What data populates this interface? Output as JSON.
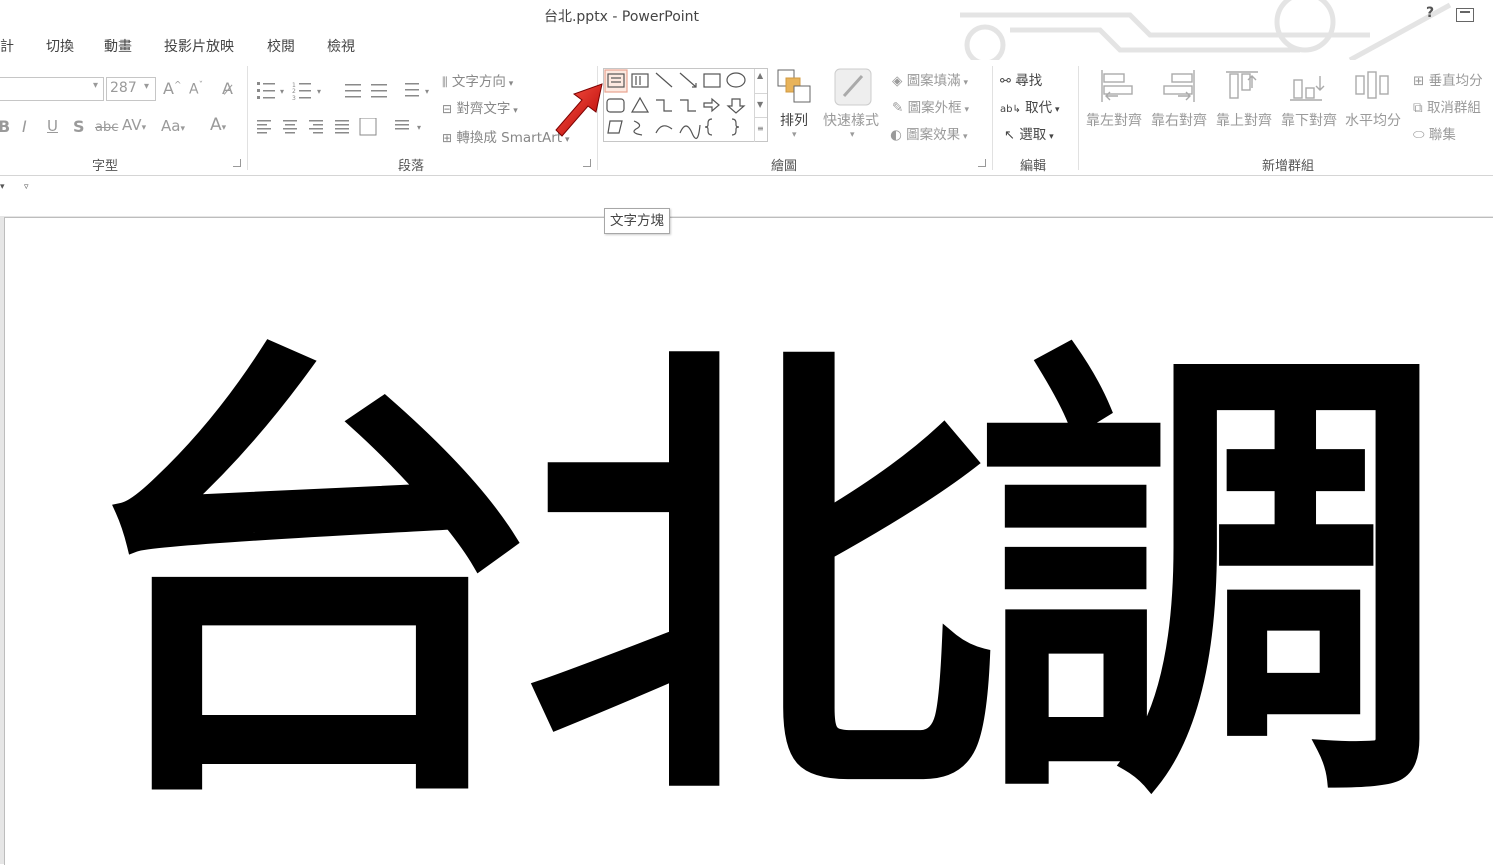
{
  "window": {
    "title": "台北.pptx - PowerPoint",
    "help": "?"
  },
  "tabs": [
    "計",
    "切換",
    "動畫",
    "投影片放映",
    "校閱",
    "檢視"
  ],
  "font_group": {
    "font_size": "287",
    "label": "字型"
  },
  "paragraph_group": {
    "text_direction": "文字方向",
    "align_text": "對齊文字",
    "convert_smartart": "轉換成 SmartArt",
    "label": "段落"
  },
  "drawing_group": {
    "arrange": "排列",
    "quick_styles": "快速樣式",
    "shape_fill": "圖案填滿",
    "shape_outline": "圖案外框",
    "shape_effects": "圖案效果",
    "label": "繪圖"
  },
  "editing_group": {
    "find": "尋找",
    "replace": "取代",
    "select": "選取",
    "label": "編輯"
  },
  "custom_group": {
    "align_left": "靠左對齊",
    "align_right": "靠右對齊",
    "align_top": "靠上對齊",
    "align_bottom": "靠下對齊",
    "distribute_h": "水平均分",
    "distribute_v": "垂直均分",
    "ungroup": "取消群組",
    "group": "聯集",
    "label": "新增群組"
  },
  "tooltip": "文字方塊",
  "slide": {
    "text": "台北調"
  }
}
